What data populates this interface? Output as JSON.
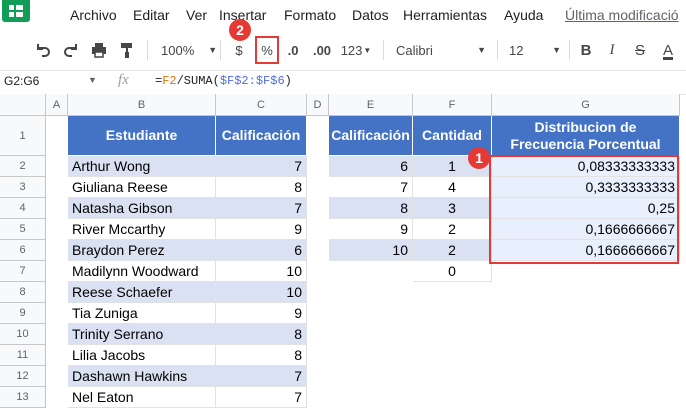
{
  "menu": {
    "items": [
      "Archivo",
      "Editar",
      "Ver",
      "Insertar",
      "Formato",
      "Datos",
      "Herramientas",
      "Ayuda"
    ],
    "last_edit": "Última modificació"
  },
  "toolbar": {
    "zoom": "100%",
    "currency": "$",
    "percent": "%",
    "dec_decrease": ".0",
    "dec_increase": ".00",
    "more_formats": "123",
    "font": "Calibri",
    "font_size": "12",
    "bold": "B",
    "italic": "I",
    "strike": "S",
    "text_color": "A"
  },
  "formula_bar": {
    "name_box": "G2:G6",
    "fx": "fx",
    "formula_prefix": "=",
    "formula_ref": "F2",
    "formula_mid": "/SUMA(",
    "formula_range": "$F$2:$F$6",
    "formula_suffix": ")"
  },
  "columns": [
    "A",
    "B",
    "C",
    "D",
    "E",
    "F",
    "G"
  ],
  "rows": [
    "1",
    "2",
    "3",
    "4",
    "5",
    "6",
    "7",
    "8",
    "9",
    "10",
    "11",
    "12",
    "13"
  ],
  "table1": {
    "header": [
      "Estudiante",
      "Calificación"
    ],
    "rows": [
      [
        "Arthur Wong",
        "7"
      ],
      [
        "Giuliana Reese",
        "8"
      ],
      [
        "Natasha Gibson",
        "7"
      ],
      [
        "River Mccarthy",
        "9"
      ],
      [
        "Braydon Perez",
        "6"
      ],
      [
        "Madilynn Woodward",
        "10"
      ],
      [
        "Reese Schaefer",
        "10"
      ],
      [
        "Tia Zuniga",
        "9"
      ],
      [
        "Trinity Serrano",
        "8"
      ],
      [
        "Lilia Jacobs",
        "8"
      ],
      [
        "Dashawn Hawkins",
        "7"
      ],
      [
        "Nel Eaton",
        "7"
      ]
    ]
  },
  "table2": {
    "header": [
      "Calificación",
      "Cantidad",
      "Distribucion de Frecuencia Porcentual"
    ],
    "rows": [
      [
        "6",
        "1",
        "0,08333333333"
      ],
      [
        "7",
        "4",
        "0,3333333333"
      ],
      [
        "8",
        "3",
        "0,25"
      ],
      [
        "9",
        "2",
        "0,1666666667"
      ],
      [
        "10",
        "2",
        "0,1666666667"
      ]
    ],
    "extra_f7": "0"
  },
  "badges": {
    "one": "1",
    "two": "2"
  },
  "colors": {
    "header_bg": "#4472c4",
    "stripe": "#d9e1f2",
    "highlight": "#e53935",
    "selection": "#e8f0fe"
  }
}
